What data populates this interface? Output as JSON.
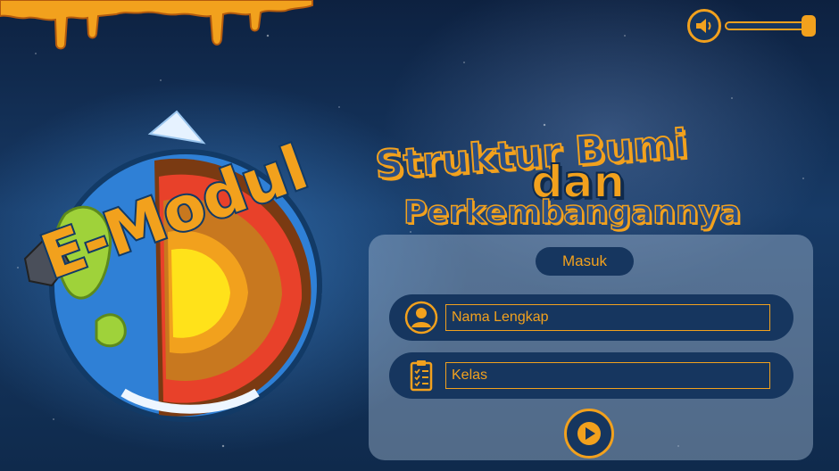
{
  "title": {
    "line1": "Struktur Bumi",
    "line2": "dan",
    "line3": "Perkembangannya"
  },
  "logo": {
    "text": "E-Modul"
  },
  "form": {
    "masuk_label": "Masuk",
    "name_placeholder": "Nama Lengkap",
    "class_placeholder": "Kelas"
  },
  "icons": {
    "volume": "speaker-icon",
    "name": "user-icon",
    "class": "clipboard-icon",
    "play": "play-icon"
  },
  "volume": {
    "level": 1.0
  },
  "colors": {
    "accent": "#f2a11d",
    "panel_dark": "#16365f",
    "background": "#173a66"
  }
}
